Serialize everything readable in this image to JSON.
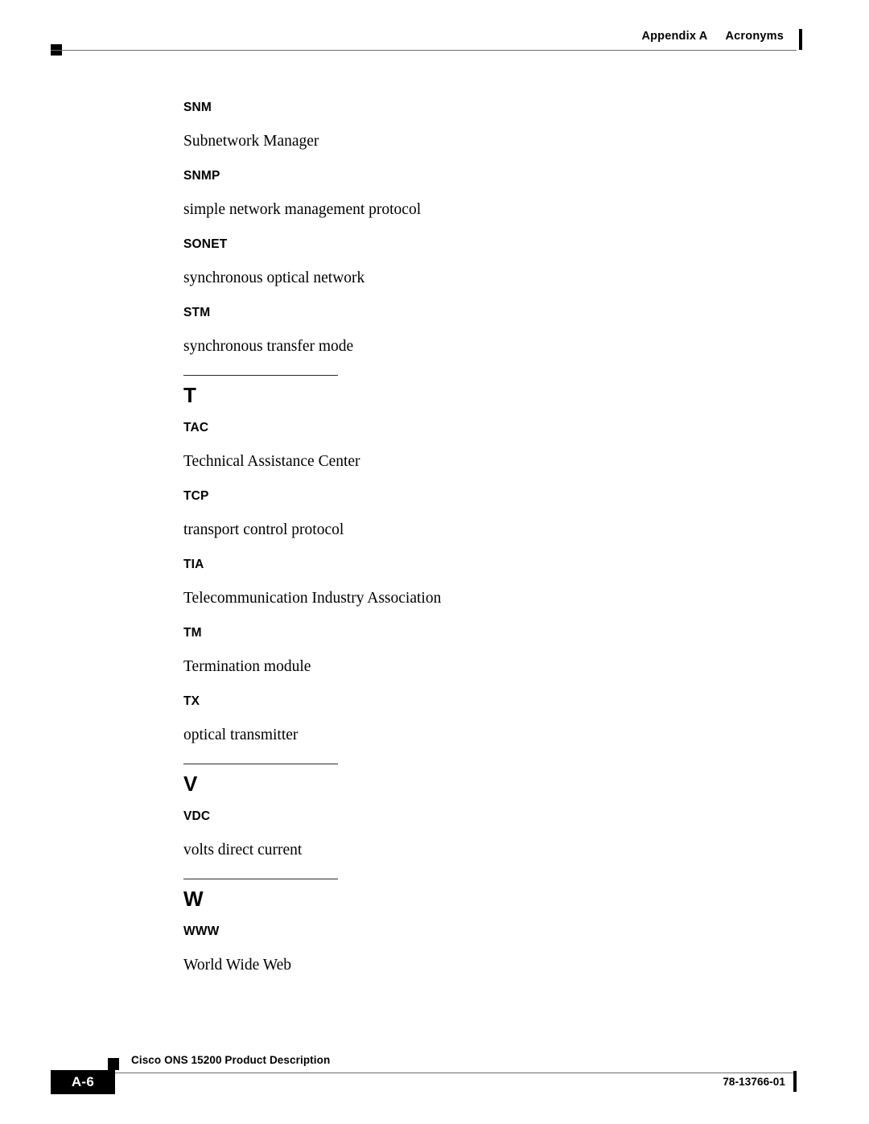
{
  "header": {
    "appendix_label": "Appendix A",
    "appendix_title": "Acronyms",
    "change_bar": "change-bar-marker"
  },
  "content": {
    "blocks": [
      {
        "kind": "entry",
        "term": "SNM",
        "definition": "Subnetwork Manager"
      },
      {
        "kind": "entry",
        "term": "SNMP",
        "definition": "simple network management protocol"
      },
      {
        "kind": "entry",
        "term": "SONET",
        "definition": "synchronous optical network"
      },
      {
        "kind": "entry",
        "term": "STM",
        "definition": "synchronous transfer mode"
      },
      {
        "kind": "section",
        "letter": "T"
      },
      {
        "kind": "entry",
        "term": "TAC",
        "definition": "Technical Assistance Center"
      },
      {
        "kind": "entry",
        "term": "TCP",
        "definition": "transport control protocol"
      },
      {
        "kind": "entry",
        "term": "TIA",
        "definition": "Telecommunication Industry Association"
      },
      {
        "kind": "entry",
        "term": "TM",
        "definition": "Termination module"
      },
      {
        "kind": "entry",
        "term": "TX",
        "definition": "optical transmitter"
      },
      {
        "kind": "section",
        "letter": "V"
      },
      {
        "kind": "entry",
        "term": "VDC",
        "definition": "volts direct current"
      },
      {
        "kind": "section",
        "letter": "W"
      },
      {
        "kind": "entry",
        "term": "WWW",
        "definition": "World Wide Web"
      }
    ]
  },
  "footer": {
    "page_number": "A-6",
    "document_title": "Cisco ONS 15200 Product Description",
    "document_number": "78-13766-01",
    "change_bar": "change-bar-marker"
  }
}
